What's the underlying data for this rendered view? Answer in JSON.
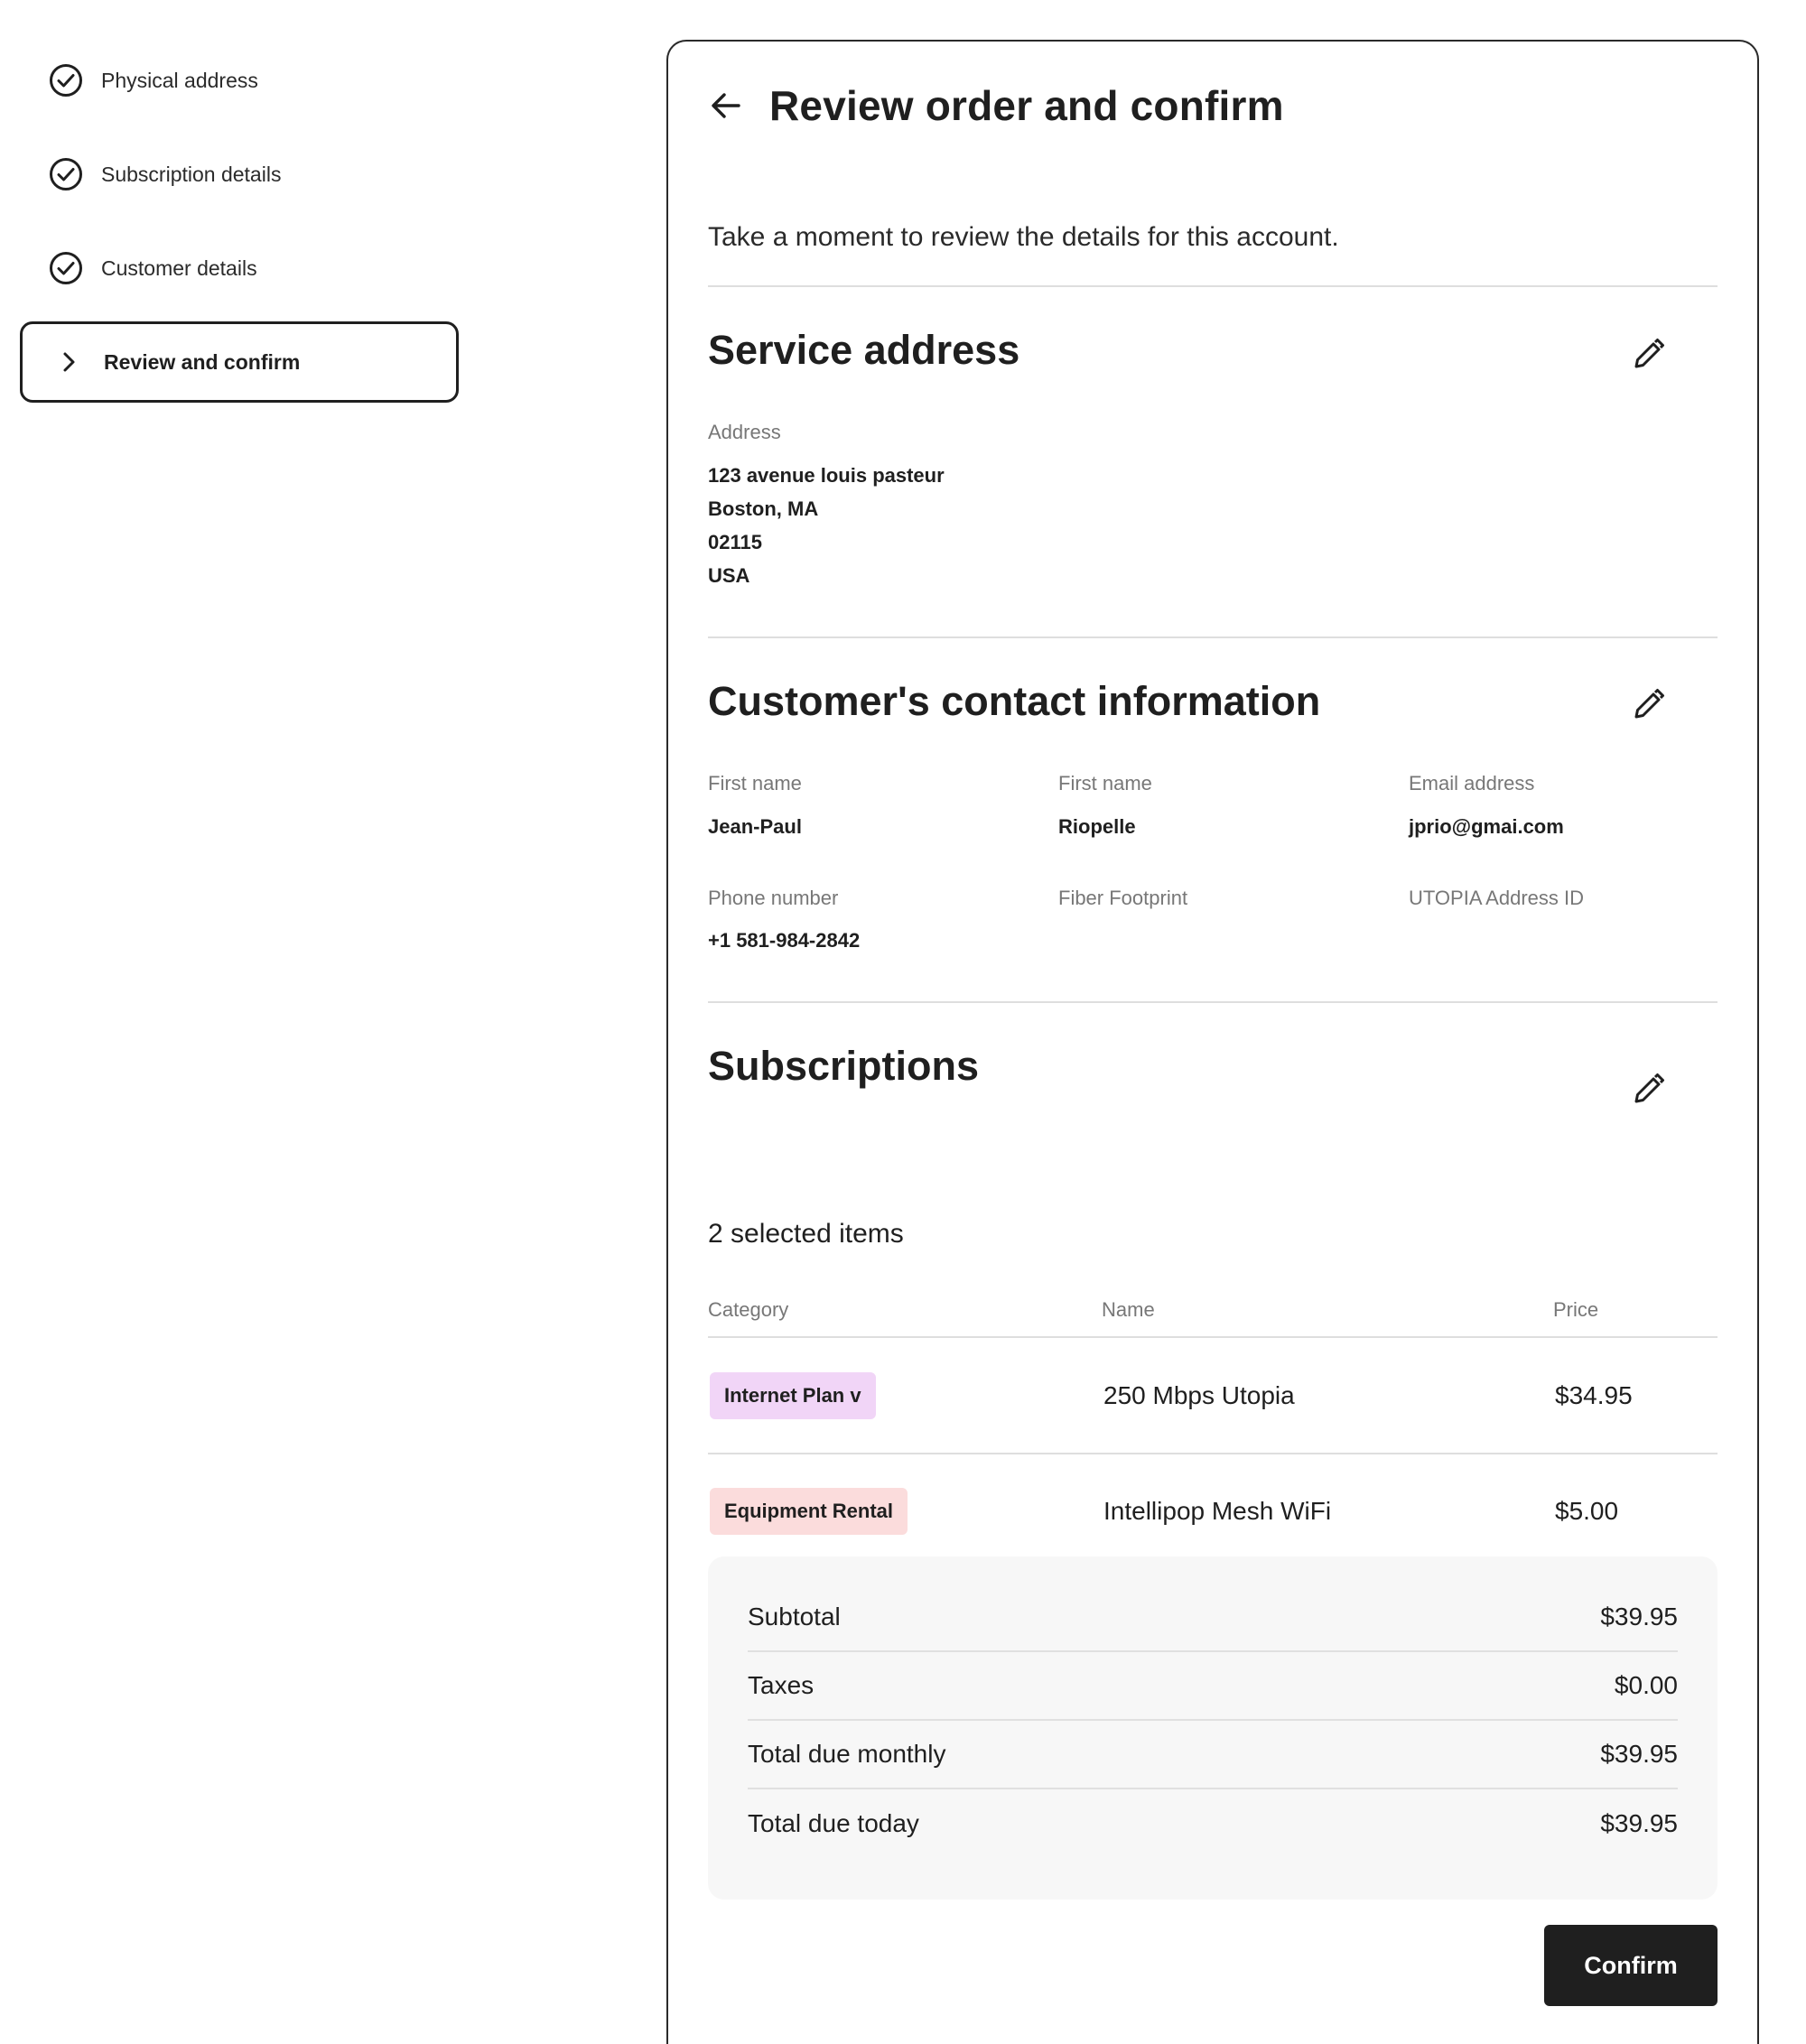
{
  "stepper": {
    "steps": [
      {
        "label": "Physical address",
        "status": "complete",
        "icon": "check-circle-icon"
      },
      {
        "label": "Subscription details",
        "status": "complete",
        "icon": "check-circle-icon"
      },
      {
        "label": "Customer details",
        "status": "complete",
        "icon": "check-circle-icon"
      },
      {
        "label": "Review and confirm",
        "status": "current",
        "icon": "chevron-right-icon"
      }
    ]
  },
  "header": {
    "title": "Review order and confirm",
    "back_icon": "arrow-left-icon"
  },
  "intro": "Take a moment to review the details for this account.",
  "service_address": {
    "title": "Service address",
    "edit_icon": "pencil-icon",
    "label": "Address",
    "lines": [
      "123 avenue louis pasteur",
      "Boston, MA",
      "02115",
      "USA"
    ]
  },
  "contact": {
    "title": "Customer's contact information",
    "edit_icon": "pencil-icon",
    "fields": [
      {
        "label": "First name",
        "value": "Jean-Paul"
      },
      {
        "label": "First name",
        "value": "Riopelle"
      },
      {
        "label": "Email address",
        "value": "jprio@gmai.com"
      },
      {
        "label": "Phone number",
        "value": "+1 581-984-2842"
      },
      {
        "label": "Fiber Footprint",
        "value": ""
      },
      {
        "label": "UTOPIA Address ID",
        "value": ""
      }
    ]
  },
  "subscriptions": {
    "title": "Subscriptions",
    "edit_icon": "pencil-icon",
    "selected_count": "2 selected items",
    "columns": [
      "Category",
      "Name",
      "Price"
    ],
    "rows": [
      {
        "category": "Internet Plan v",
        "category_color": "#f1d5f7",
        "name": "250 Mbps Utopia",
        "price": "$34.95"
      },
      {
        "category": "Equipment Rental",
        "category_color": "#fbdcdc",
        "name": "Intellipop Mesh WiFi",
        "price": "$5.00"
      }
    ]
  },
  "summary": [
    {
      "label": "Subtotal",
      "value": "$39.95"
    },
    {
      "label": "Taxes",
      "value": "$0.00"
    },
    {
      "label": "Total due monthly",
      "value": "$39.95"
    },
    {
      "label": "Total due today",
      "value": "$39.95"
    }
  ],
  "confirm_label": "Confirm",
  "colors": {
    "text": "#1f1f1f",
    "muted": "#777777",
    "divider": "#dedede",
    "summary_bg": "#f7f7f7",
    "button_bg": "#1f1f1f"
  }
}
